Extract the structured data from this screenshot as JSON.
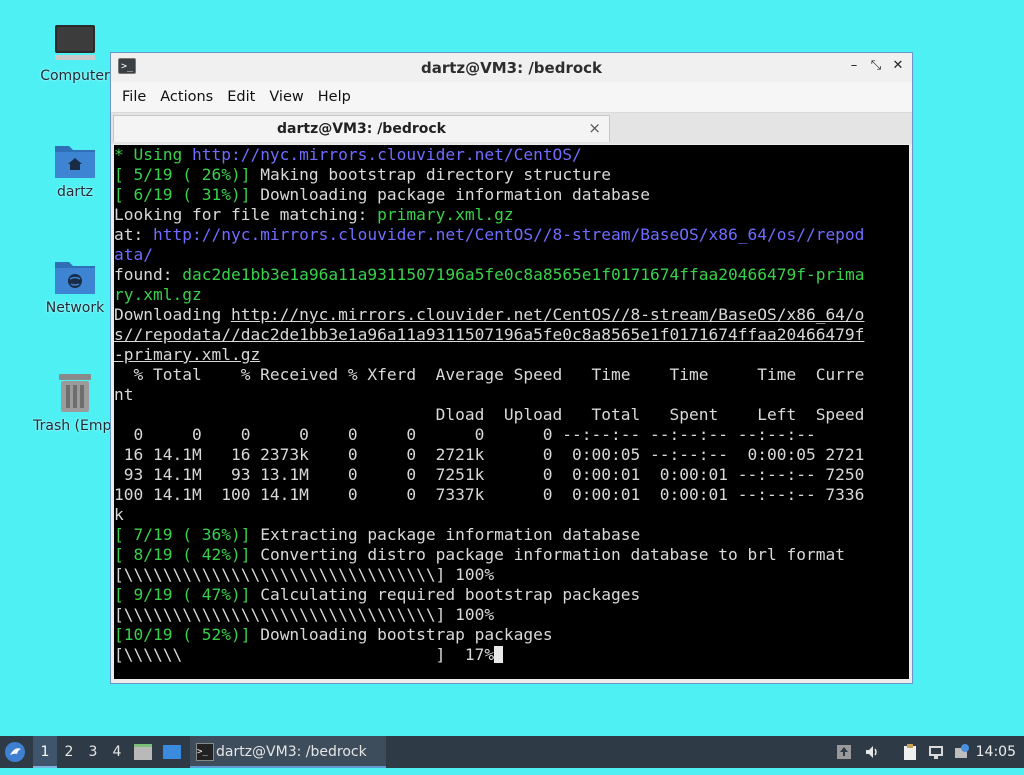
{
  "desktop": {
    "icons": [
      {
        "label": "Computer"
      },
      {
        "label": "dartz"
      },
      {
        "label": "Network"
      },
      {
        "label": "Trash (Empt"
      }
    ]
  },
  "window": {
    "title": "dartz@VM3: /bedrock",
    "menu": [
      "File",
      "Actions",
      "Edit",
      "View",
      "Help"
    ],
    "tab_title": "dartz@VM3: /bedrock",
    "controls": {
      "minimize": "–",
      "maximize": "⤡",
      "close": "✕"
    },
    "tab_close": "×"
  },
  "terminal": {
    "lines": [
      [
        {
          "t": "* Using ",
          "c": "green"
        },
        {
          "t": "http://nyc.mirrors.clouvider.net/CentOS/",
          "c": "blue"
        }
      ],
      [
        {
          "t": "[ 5/19 ( 26%)]",
          "c": "green"
        },
        {
          "t": " Making bootstrap directory structure",
          "c": "white"
        }
      ],
      [
        {
          "t": "[ 6/19 ( 31%)]",
          "c": "green"
        },
        {
          "t": " Downloading package information database",
          "c": "white"
        }
      ],
      [
        {
          "t": "Looking for file matching: ",
          "c": "white"
        },
        {
          "t": "primary.xml.gz",
          "c": "green"
        }
      ],
      [
        {
          "t": "at: ",
          "c": "white"
        },
        {
          "t": "http://nyc.mirrors.clouvider.net/CentOS//8-stream/BaseOS/x86_64/os//repod",
          "c": "blue"
        }
      ],
      [
        {
          "t": "ata/",
          "c": "blue"
        }
      ],
      [
        {
          "t": "found: ",
          "c": "white"
        },
        {
          "t": "dac2de1bb3e1a96a11a9311507196a5fe0c8a8565e1f0171674ffaa20466479f-prima",
          "c": "green"
        }
      ],
      [
        {
          "t": "ry.xml.gz",
          "c": "green"
        }
      ],
      [
        {
          "t": "Downloading ",
          "c": "white"
        },
        {
          "t": "http://nyc.mirrors.clouvider.net/CentOS//8-stream/BaseOS/x86_64/o",
          "c": "white",
          "u": true
        }
      ],
      [
        {
          "t": "s//repodata//dac2de1bb3e1a96a11a9311507196a5fe0c8a8565e1f0171674ffaa20466479f",
          "c": "white",
          "u": true
        }
      ],
      [
        {
          "t": "-primary.xml.gz",
          "c": "white",
          "u": true
        }
      ],
      [
        {
          "t": "  % Total    % Received % Xferd  Average Speed   Time    Time     Time  Curre",
          "c": "white"
        }
      ],
      [
        {
          "t": "nt",
          "c": "white"
        }
      ],
      [
        {
          "t": "                                 Dload  Upload   Total   Spent    Left  Speed",
          "c": "white"
        }
      ],
      [
        {
          "t": "  0     0    0     0    0     0      0      0 --:--:-- --:--:-- --:--:--",
          "c": "white"
        }
      ],
      [
        {
          "t": " 16 14.1M   16 2373k    0     0  2721k      0  0:00:05 --:--:--  0:00:05 2721",
          "c": "white"
        }
      ],
      [
        {
          "t": " 93 14.1M   93 13.1M    0     0  7251k      0  0:00:01  0:00:01 --:--:-- 7250",
          "c": "white"
        }
      ],
      [
        {
          "t": "100 14.1M  100 14.1M    0     0  7337k      0  0:00:01  0:00:01 --:--:-- 7336",
          "c": "white"
        }
      ],
      [
        {
          "t": "k",
          "c": "white"
        }
      ],
      [
        {
          "t": "[ 7/19 ( 36%)]",
          "c": "green"
        },
        {
          "t": " Extracting package information database",
          "c": "white"
        }
      ],
      [
        {
          "t": "[ 8/19 ( 42%)]",
          "c": "green"
        },
        {
          "t": " Converting distro package information database to brl format",
          "c": "white"
        }
      ],
      [
        {
          "t": "[\\\\\\\\\\\\\\\\\\\\\\\\\\\\\\\\\\\\\\\\\\\\\\\\\\\\\\\\\\\\\\\\] 100%",
          "c": "white"
        }
      ],
      [
        {
          "t": "[ 9/19 ( 47%)]",
          "c": "green"
        },
        {
          "t": " Calculating required bootstrap packages",
          "c": "white"
        }
      ],
      [
        {
          "t": "[\\\\\\\\\\\\\\\\\\\\\\\\\\\\\\\\\\\\\\\\\\\\\\\\\\\\\\\\\\\\\\\\] 100%",
          "c": "white"
        }
      ],
      [
        {
          "t": "[10/19 ( 52%)]",
          "c": "green"
        },
        {
          "t": " Downloading bootstrap packages",
          "c": "white"
        }
      ],
      [
        {
          "t": "[\\\\\\\\\\\\                          ]  17%",
          "c": "white"
        }
      ]
    ]
  },
  "taskbar": {
    "workspaces": [
      "1",
      "2",
      "3",
      "4"
    ],
    "active_workspace": "1",
    "task_label": "dartz@VM3: /bedrock",
    "clock": "14:05"
  },
  "icons": {
    "start": "distro-logo-icon",
    "file_manager": "folder-icon",
    "show_desktop": "desktop-icon",
    "tray": [
      "upload-icon",
      "volume-icon",
      "clipboard-icon",
      "network-icon",
      "update-icon"
    ]
  }
}
